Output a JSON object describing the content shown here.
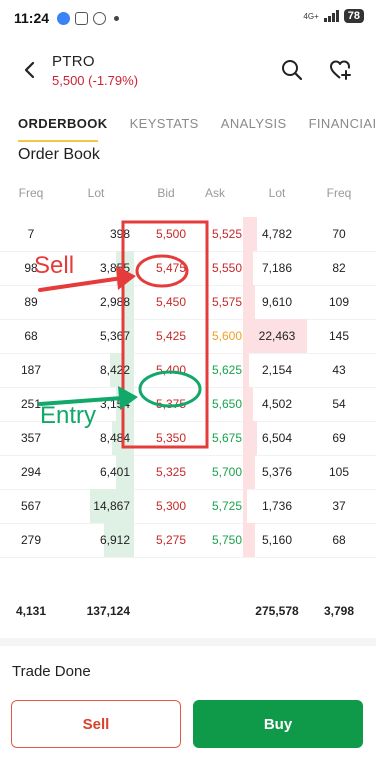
{
  "status_bar": {
    "time": "11:24",
    "network": "4G+",
    "battery": "78"
  },
  "header": {
    "ticker": "PTRO",
    "price": "5,500",
    "change": "(-1.79%)"
  },
  "tabs": [
    {
      "label": "ORDERBOOK",
      "active": true
    },
    {
      "label": "KEYSTATS",
      "active": false
    },
    {
      "label": "ANALYSIS",
      "active": false
    },
    {
      "label": "FINANCIAI",
      "active": false
    }
  ],
  "section_title": "Order Book",
  "orderbook": {
    "columns": {
      "freq": "Freq",
      "lot": "Lot",
      "bid": "Bid",
      "ask": "Ask",
      "lot2": "Lot",
      "freq2": "Freq"
    },
    "rows": [
      {
        "bid_freq": "7",
        "bid_lot": "398",
        "bid": "5,500",
        "ask": "5,525",
        "ask_lot": "4,782",
        "ask_freq": "70",
        "ask_color": "#c62828"
      },
      {
        "bid_freq": "98",
        "bid_lot": "3,855",
        "bid": "5,475",
        "ask": "5,550",
        "ask_lot": "7,186",
        "ask_freq": "82",
        "ask_color": "#c62828"
      },
      {
        "bid_freq": "89",
        "bid_lot": "2,988",
        "bid": "5,450",
        "ask": "5,575",
        "ask_lot": "9,610",
        "ask_freq": "109",
        "ask_color": "#c62828"
      },
      {
        "bid_freq": "68",
        "bid_lot": "5,367",
        "bid": "5,425",
        "ask": "5,600",
        "ask_lot": "22,463",
        "ask_freq": "145",
        "ask_color": "#f0a020"
      },
      {
        "bid_freq": "187",
        "bid_lot": "8,422",
        "bid": "5,400",
        "ask": "5,625",
        "ask_lot": "2,154",
        "ask_freq": "43",
        "ask_color": "#16a34a"
      },
      {
        "bid_freq": "251",
        "bid_lot": "3,154",
        "bid": "5,375",
        "ask": "5,650",
        "ask_lot": "4,502",
        "ask_freq": "54",
        "ask_color": "#16a34a"
      },
      {
        "bid_freq": "357",
        "bid_lot": "8,484",
        "bid": "5,350",
        "ask": "5,675",
        "ask_lot": "6,504",
        "ask_freq": "69",
        "ask_color": "#16a34a"
      },
      {
        "bid_freq": "294",
        "bid_lot": "6,401",
        "bid": "5,325",
        "ask": "5,700",
        "ask_lot": "5,376",
        "ask_freq": "105",
        "ask_color": "#16a34a"
      },
      {
        "bid_freq": "567",
        "bid_lot": "14,867",
        "bid": "5,300",
        "ask": "5,725",
        "ask_lot": "1,736",
        "ask_freq": "37",
        "ask_color": "#16a34a"
      },
      {
        "bid_freq": "279",
        "bid_lot": "6,912",
        "bid": "5,275",
        "ask": "5,750",
        "ask_lot": "5,160",
        "ask_freq": "68",
        "ask_color": "#16a34a"
      }
    ],
    "totals": {
      "bid_freq": "4,131",
      "bid_lot": "137,124",
      "ask_lot": "275,578",
      "ask_freq": "3,798"
    }
  },
  "trade_done": "Trade Done",
  "buttons": {
    "sell": "Sell",
    "buy": "Buy"
  },
  "annotations": {
    "sell_label": "Sell",
    "entry_label": "Entry"
  },
  "colors": {
    "bid_red": "#c62828",
    "buy_green": "#0f9a4a",
    "sell_orange_red": "#d8422f",
    "annotation_red": "#e53b3b",
    "annotation_green": "#11a86a"
  }
}
